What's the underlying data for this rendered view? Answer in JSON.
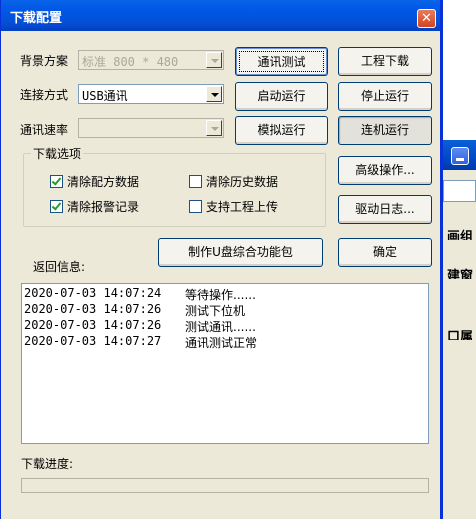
{
  "dialog": {
    "title": "下载配置",
    "close_glyph": "✕"
  },
  "settings": {
    "background_label": "背景方案",
    "background_value": "标准 800 * 480",
    "connection_label": "连接方式",
    "connection_value": "USB通讯",
    "baud_label": "通讯速率",
    "baud_value": ""
  },
  "buttons": {
    "comm_test": "通讯测试",
    "start_run": "启动运行",
    "sim_run": "模拟运行",
    "project_download": "工程下载",
    "stop_run": "停止运行",
    "online_run": "连机运行",
    "advanced": "高级操作...",
    "driver_log": "驱动日志...",
    "make_usb_package": "制作U盘综合功能包",
    "ok": "确定"
  },
  "download_options": {
    "title": "下载选项",
    "items": [
      {
        "label": "清除配方数据",
        "checked": true
      },
      {
        "label": "清除历史数据",
        "checked": false
      },
      {
        "label": "清除报警记录",
        "checked": true
      },
      {
        "label": "支持工程上传",
        "checked": false
      }
    ]
  },
  "return_info": {
    "label": "返回信息:",
    "logs": [
      {
        "time": "2020-07-03 14:07:24",
        "message": "等待操作......"
      },
      {
        "time": "2020-07-03 14:07:26",
        "message": "测试下位机"
      },
      {
        "time": "2020-07-03 14:07:26",
        "message": "测试通讯......"
      },
      {
        "time": "2020-07-03 14:07:27",
        "message": "通讯测试正常"
      }
    ]
  },
  "progress": {
    "label": "下载进度:",
    "value": 0
  },
  "background_window": {
    "row1": "画组",
    "row2": "建窗",
    "row3": "口属"
  }
}
